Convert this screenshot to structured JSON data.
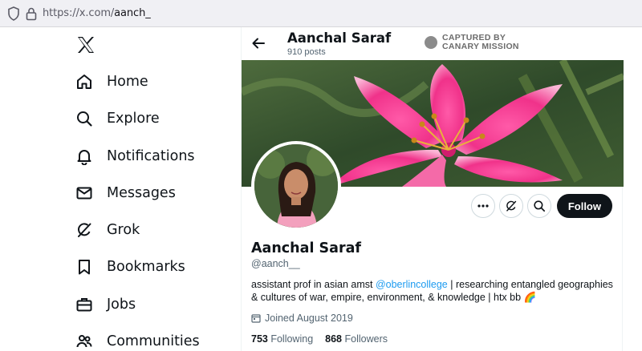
{
  "browser": {
    "url_host": "https://x.com/",
    "url_path": "aanch_"
  },
  "sidebar": {
    "logo": "x-logo",
    "items": [
      {
        "label": "Home",
        "icon": "home-icon"
      },
      {
        "label": "Explore",
        "icon": "search-icon"
      },
      {
        "label": "Notifications",
        "icon": "bell-icon"
      },
      {
        "label": "Messages",
        "icon": "envelope-icon"
      },
      {
        "label": "Grok",
        "icon": "grok-icon"
      },
      {
        "label": "Bookmarks",
        "icon": "bookmark-icon"
      },
      {
        "label": "Jobs",
        "icon": "briefcase-icon"
      },
      {
        "label": "Communities",
        "icon": "people-icon"
      }
    ]
  },
  "header": {
    "name": "Aanchal Saraf",
    "posts": "910 posts",
    "watermark_line1": "CAPTURED BY",
    "watermark_line2": "CANARY MISSION"
  },
  "profile": {
    "name": "Aanchal Saraf",
    "handle": "@aanch__",
    "bio_before": "assistant prof in asian amst ",
    "bio_mention": "@oberlincollege",
    "bio_after": " | researching entangled geographies & cultures of war, empire, environment, & knowledge | htx bb 🌈",
    "joined": "Joined August 2019",
    "following_count": "753",
    "following_label": "Following",
    "followers_count": "868",
    "followers_label": "Followers",
    "follow_button": "Follow"
  },
  "colors": {
    "accent": "#1d9bf0",
    "text": "#0f1419",
    "muted": "#536471",
    "button": "#0f1419"
  }
}
